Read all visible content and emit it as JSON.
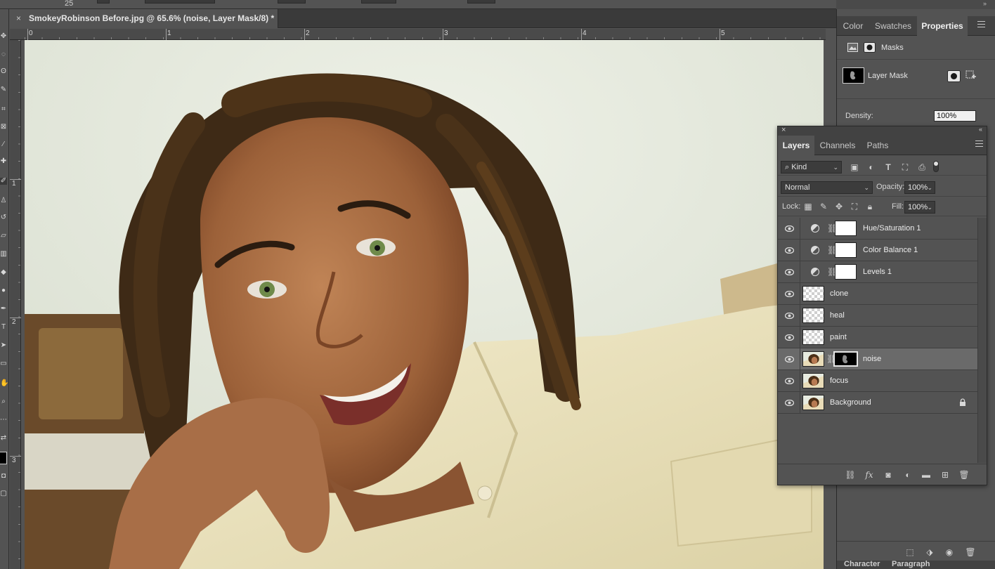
{
  "option_bar": {
    "brush_size": "25"
  },
  "document": {
    "tab_title": "SmokeyRobinson Before.jpg @ 65.6% (noise, Layer Mask/8) *",
    "close_glyph": "×"
  },
  "rulers": {
    "horizontal_labels": [
      "0",
      "1",
      "2",
      "3",
      "4",
      "5"
    ],
    "vertical_labels": [
      "1",
      "2",
      "3"
    ]
  },
  "properties_panel": {
    "tabs": [
      {
        "label": "Color",
        "active": false
      },
      {
        "label": "Swatches",
        "active": false
      },
      {
        "label": "Properties",
        "active": true
      }
    ],
    "section_label": "Masks",
    "layer_mask_label": "Layer Mask",
    "density_label": "Density:",
    "density_value": "100%"
  },
  "layers_panel": {
    "tabs": [
      {
        "label": "Layers",
        "active": true
      },
      {
        "label": "Channels",
        "active": false
      },
      {
        "label": "Paths",
        "active": false
      }
    ],
    "filter_kind": "Kind",
    "blend_mode": "Normal",
    "opacity_label": "Opacity:",
    "opacity_value": "100%",
    "lock_label": "Lock:",
    "fill_label": "Fill:",
    "fill_value": "100%",
    "layers": [
      {
        "name": "Hue/Saturation 1",
        "kind": "adjustment",
        "thumb": "white",
        "visible": true,
        "selected": false
      },
      {
        "name": "Color Balance 1",
        "kind": "adjustment",
        "thumb": "white",
        "visible": true,
        "selected": false
      },
      {
        "name": "Levels 1",
        "kind": "adjustment",
        "thumb": "white",
        "visible": true,
        "selected": false
      },
      {
        "name": "clone",
        "kind": "pixel",
        "thumb": "checker",
        "visible": true,
        "selected": false
      },
      {
        "name": "heal",
        "kind": "pixel",
        "thumb": "checker",
        "visible": true,
        "selected": false
      },
      {
        "name": "paint",
        "kind": "pixel",
        "thumb": "checker",
        "visible": true,
        "selected": false
      },
      {
        "name": "noise",
        "kind": "masked",
        "thumb": "photo",
        "visible": true,
        "selected": true
      },
      {
        "name": "focus",
        "kind": "pixel",
        "thumb": "photo",
        "visible": true,
        "selected": false
      },
      {
        "name": "Background",
        "kind": "background",
        "thumb": "photo",
        "visible": true,
        "selected": false,
        "locked": true
      }
    ],
    "footer_fx": "fx"
  },
  "dock_bottom_tabs": [
    "Character",
    "Paragraph"
  ],
  "colors": {
    "ui_bg": "#535353",
    "panel_tab_bg": "#424242",
    "selected_layer": "#6a6a6a",
    "canvas_wall": "#e3e8dc",
    "shirt": "#ece4bf",
    "skin": "#a66c45",
    "hair": "#3e2a16"
  }
}
